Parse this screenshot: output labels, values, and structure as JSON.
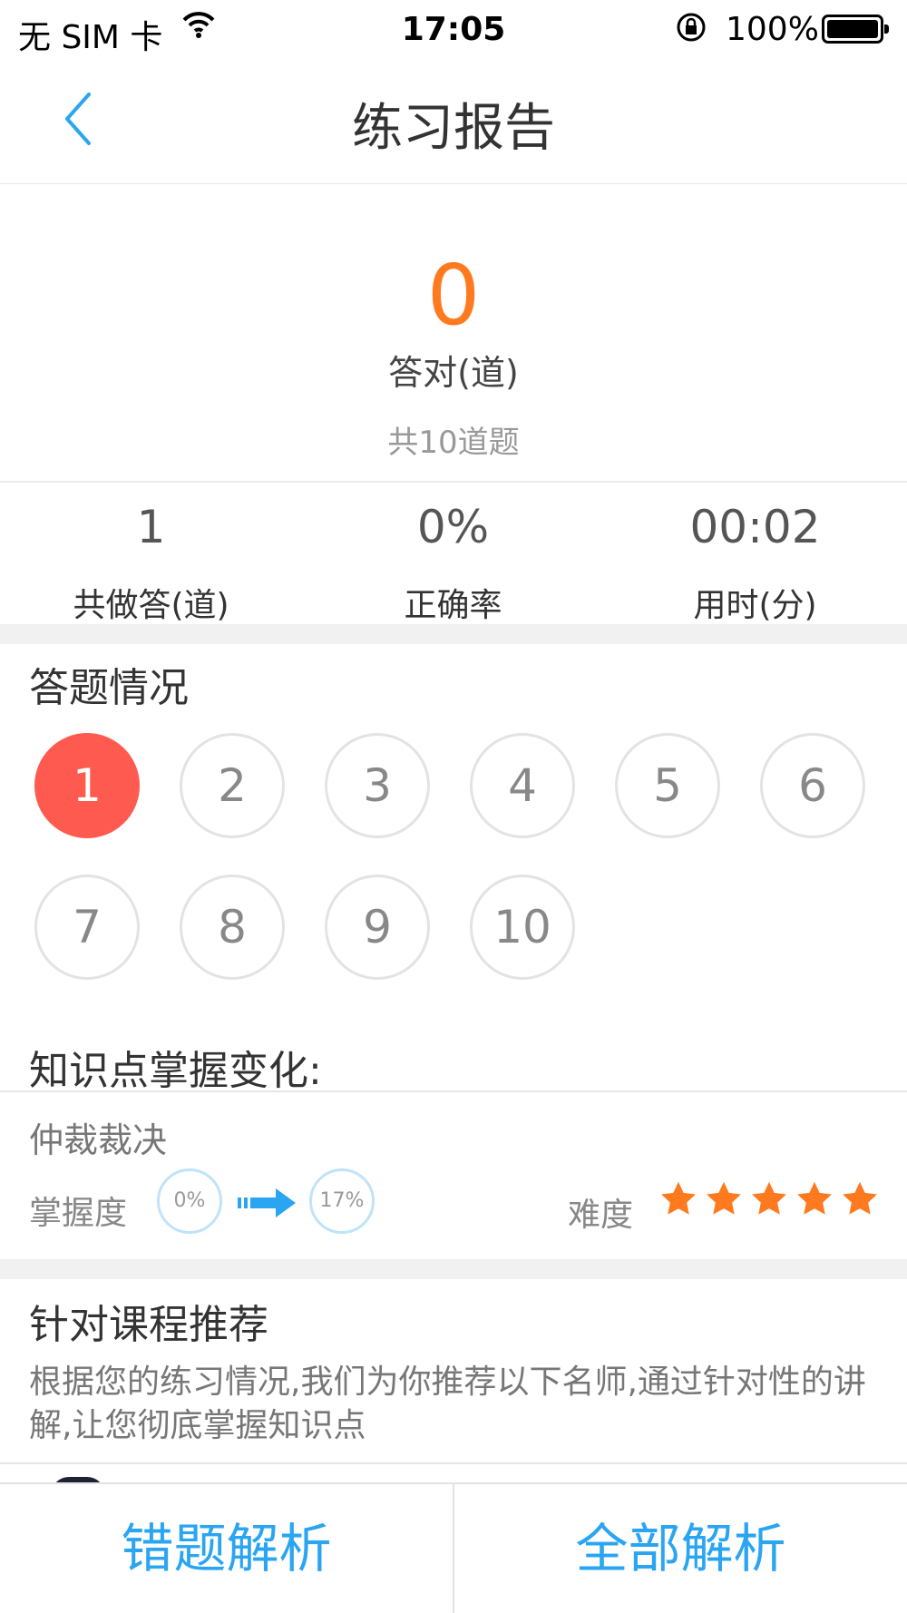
{
  "status_bar": {
    "carrier": "无 SIM 卡",
    "time": "17:05",
    "battery": "100%"
  },
  "nav": {
    "title": "练习报告"
  },
  "score": {
    "correct": "0",
    "correct_label": "答对(道)",
    "total": "共10道题"
  },
  "stats": [
    {
      "value": "1",
      "label": "共做答(道)"
    },
    {
      "value": "0%",
      "label": "正确率"
    },
    {
      "value": "00:02",
      "label": "用时(分)"
    }
  ],
  "answers": {
    "title": "答题情况",
    "items": [
      "1",
      "2",
      "3",
      "4",
      "5",
      "6",
      "7",
      "8",
      "9",
      "10"
    ],
    "active": "1",
    "active_color": "#ff5a4f"
  },
  "knowledge": {
    "title": "知识点掌握变化:",
    "name": "仲裁裁决",
    "mastery_label": "掌握度",
    "from": "0%",
    "to": "17%",
    "difficulty_label": "难度",
    "difficulty_stars": 5,
    "star_color": "#ff7a1e"
  },
  "recommend": {
    "title": "针对课程推荐",
    "desc": "根据您的练习情况,我们为你推荐以下名师,通过针对性的讲解,让您彻底掌握知识点"
  },
  "bottom": {
    "wrong_label": "错题解析",
    "all_label": "全部解析",
    "accent": "#2aa5f2"
  },
  "icons": [
    "wifi-icon",
    "orientation-lock-icon",
    "battery-icon",
    "back-chevron-icon",
    "arrow-right-icon",
    "star-icon"
  ]
}
